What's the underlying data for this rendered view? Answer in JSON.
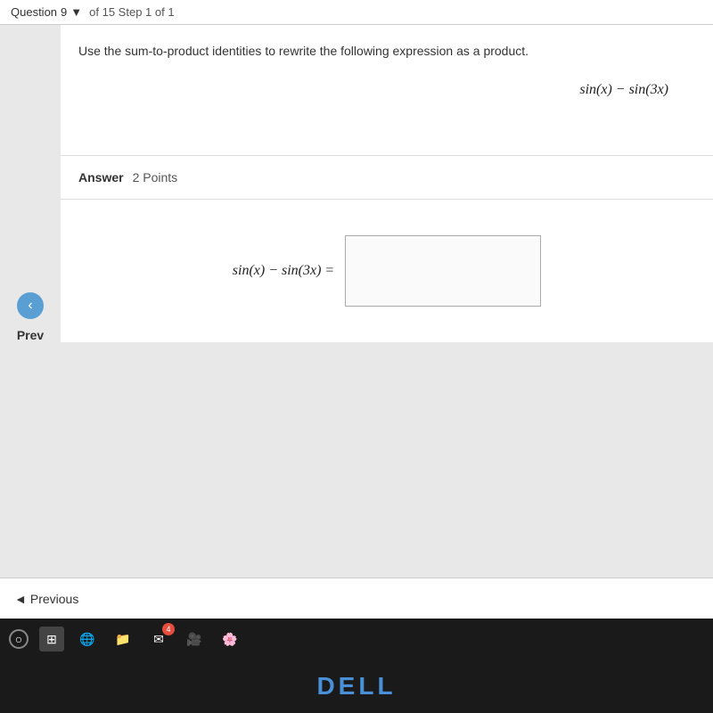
{
  "header": {
    "question_label": "Question",
    "question_number": "9",
    "dropdown_arrow": "▼",
    "step_text": "of 15 Step 1 of 1"
  },
  "question": {
    "instruction": "Use the sum-to-product identities to rewrite the following expression as a product.",
    "expression": "sin(x) − sin(3x)",
    "answer_label": "Answer",
    "points": "2 Points",
    "equation_lhs": "sin(x) − sin(3x) ="
  },
  "navigation": {
    "back_arrow": "‹",
    "prev_label": "Prev"
  },
  "bottom_nav": {
    "previous_arrow": "◄",
    "previous_label": "Previous"
  },
  "taskbar": {
    "icons": [
      "○",
      "⊞",
      "🌐",
      "📁",
      "✉",
      "🎥",
      "🌸"
    ]
  },
  "dell_brand": {
    "logo": "DELL",
    "logo_highlight": "DELL"
  }
}
